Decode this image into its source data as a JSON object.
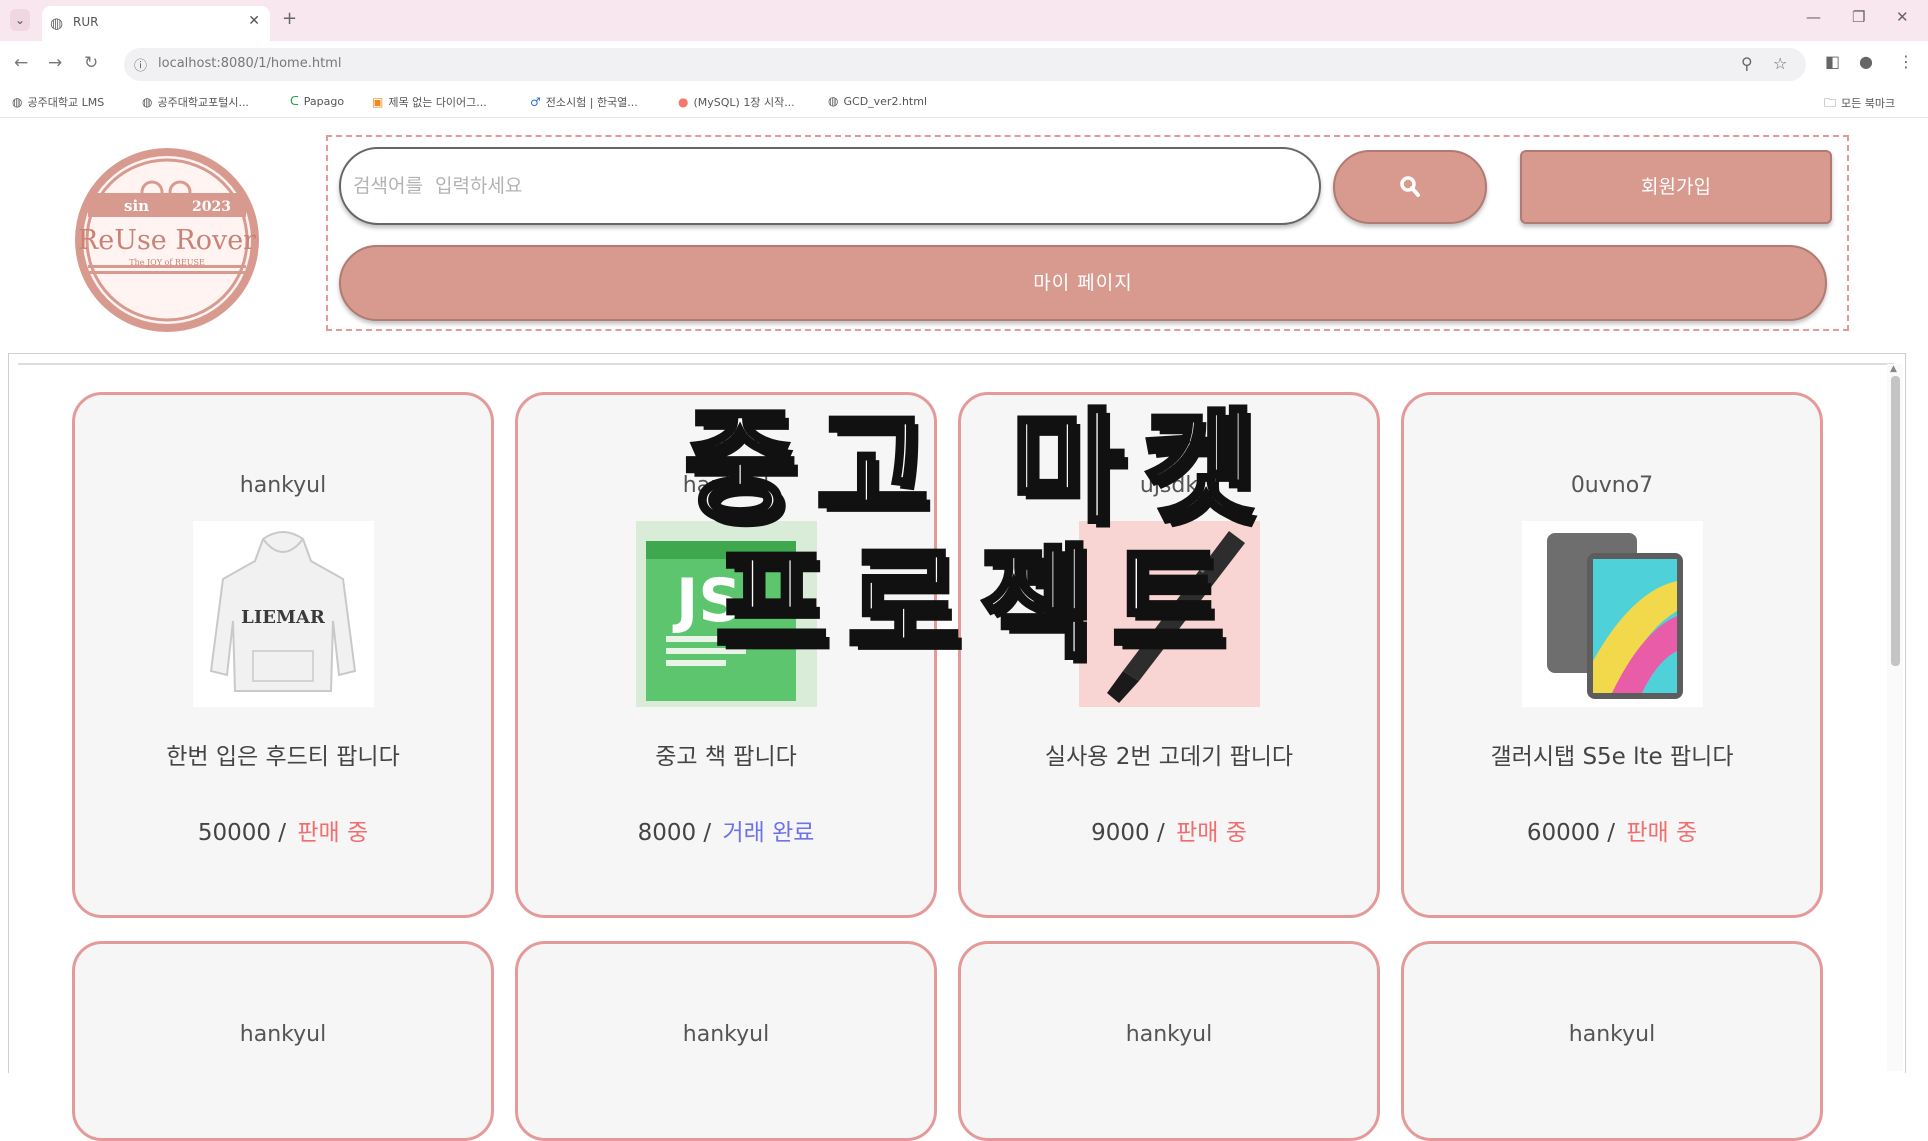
{
  "browser": {
    "tab_title": "RUR",
    "url": "localhost:8080/1/home.html",
    "bookmarks": [
      "공주대학교 LMS",
      "공주대학교포털시...",
      "Papago",
      "제목 없는 다이어그...",
      "전소시험 | 한국열...",
      "(MySQL) 1장 시작...",
      "GCD_ver2.html"
    ],
    "all_bookmarks": "모든 북마크"
  },
  "logo": {
    "line1": "sin",
    "year": "2023",
    "name": "ReUse Rover",
    "tagline": "The JOY of REUSE"
  },
  "header": {
    "search_placeholder": "검색어를  입력하세요",
    "signup_label": "회원가입",
    "mypage_label": "마이  페이지"
  },
  "overlay": {
    "line1": "중고 마켓",
    "line2": "프로젝트"
  },
  "cards": [
    {
      "user": "hankyul",
      "title": "한번 입은 후드티 팝니다",
      "price": "50000",
      "separator": " / ",
      "status": "판매 중",
      "image": "hoodie-image"
    },
    {
      "user": "hankyul",
      "title": "중고 책 팝니다",
      "price": "8000",
      "separator": " / ",
      "status": "거래 완료",
      "image": "book-image"
    },
    {
      "user": "ujsdk",
      "title": "실사용 2번 고데기 팝니다",
      "price": "9000",
      "separator": " / ",
      "status": "판매 중",
      "image": "hair-straightener-image"
    },
    {
      "user": "0uvno7",
      "title": "갤러시탭 S5e lte 팝니다",
      "price": "60000",
      "separator": " / ",
      "status": "판매 중",
      "image": "tablet-image"
    }
  ],
  "cards_row2": [
    {
      "user": "hankyul"
    },
    {
      "user": "hankyul"
    },
    {
      "user": "hankyul"
    },
    {
      "user": "hankyul"
    }
  ],
  "colors": {
    "accent": "#d89a8e",
    "card_border": "#e59a9a",
    "selling": "#f26d6d",
    "sold": "#6f73e8"
  }
}
